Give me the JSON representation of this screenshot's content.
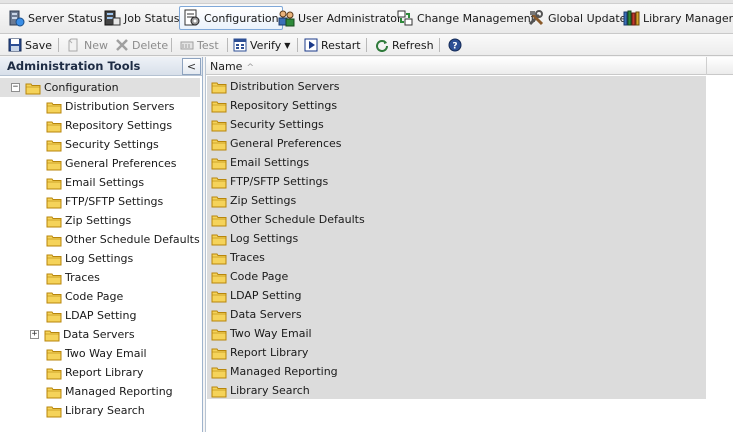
{
  "nav": {
    "items": [
      {
        "label": "Server Status",
        "icon": "server-status-icon",
        "active": false
      },
      {
        "label": "Job Status",
        "icon": "job-status-icon",
        "active": false
      },
      {
        "label": "Configuration",
        "icon": "configuration-icon",
        "active": true
      },
      {
        "label": "User Administrator",
        "icon": "users-icon",
        "active": false
      },
      {
        "label": "Change Management",
        "icon": "change-management-icon",
        "active": false
      },
      {
        "label": "Global Update",
        "icon": "tools-icon",
        "active": false
      },
      {
        "label": "Library Manager",
        "icon": "library-icon",
        "active": false
      }
    ]
  },
  "toolbar": {
    "save": "Save",
    "new": "New",
    "delete": "Delete",
    "test": "Test",
    "verify": "Verify",
    "restart": "Restart",
    "refresh": "Refresh",
    "help_icon": "help-icon"
  },
  "left_panel": {
    "title": "Administration Tools",
    "collapse_glyph": "<",
    "root": {
      "label": "Configuration",
      "expander": "−"
    },
    "children": [
      {
        "label": "Distribution Servers",
        "expander": null
      },
      {
        "label": "Repository Settings",
        "expander": null
      },
      {
        "label": "Security Settings",
        "expander": null
      },
      {
        "label": "General Preferences",
        "expander": null
      },
      {
        "label": "Email Settings",
        "expander": null
      },
      {
        "label": "FTP/SFTP Settings",
        "expander": null
      },
      {
        "label": "Zip Settings",
        "expander": null
      },
      {
        "label": "Other Schedule Defaults",
        "expander": null
      },
      {
        "label": "Log Settings",
        "expander": null
      },
      {
        "label": "Traces",
        "expander": null
      },
      {
        "label": "Code Page",
        "expander": null
      },
      {
        "label": "LDAP Setting",
        "expander": null
      },
      {
        "label": "Data Servers",
        "expander": "+"
      },
      {
        "label": "Two Way Email",
        "expander": null
      },
      {
        "label": "Report Library",
        "expander": null
      },
      {
        "label": "Managed Reporting",
        "expander": null
      },
      {
        "label": "Library Search",
        "expander": null
      }
    ]
  },
  "grid": {
    "column_header": "Name",
    "sort_glyph": "^",
    "rows": [
      "Distribution Servers",
      "Repository Settings",
      "Security Settings",
      "General Preferences",
      "Email Settings",
      "FTP/SFTP Settings",
      "Zip Settings",
      "Other Schedule Defaults",
      "Log Settings",
      "Traces",
      "Code Page",
      "LDAP Setting",
      "Data Servers",
      "Two Way Email",
      "Report Library",
      "Managed Reporting",
      "Library Search"
    ]
  },
  "colors": {
    "folder_fill": "#f5d35a",
    "folder_stroke": "#b8860b",
    "selection": "#e0e0e0",
    "grid_bg": "#dcdcdc",
    "active_border": "#7fa8d8"
  }
}
